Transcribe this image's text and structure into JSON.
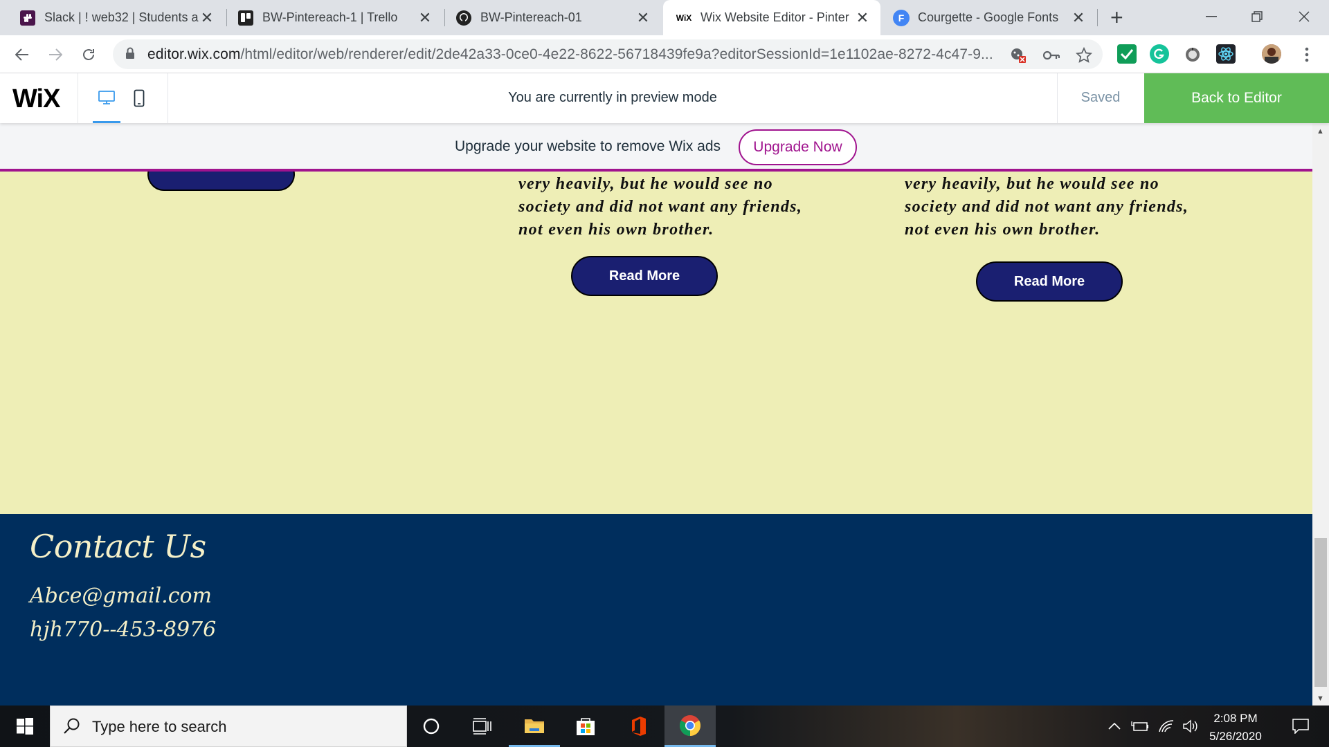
{
  "browser": {
    "tabs": [
      {
        "title": "Slack | ! web32 | Students a",
        "favicon": "slack-icon"
      },
      {
        "title": "BW-Pintereach-1 | Trello",
        "favicon": "trello-icon"
      },
      {
        "title": "BW-Pintereach-01",
        "favicon": "github-icon"
      },
      {
        "title": "Wix Website Editor - Pinter",
        "favicon": "wix-icon",
        "favicon_text": "WiX"
      },
      {
        "title": "Courgette - Google Fonts",
        "favicon": "google-fonts-icon",
        "favicon_text": "F"
      }
    ],
    "active_tab": 3,
    "url_host": "editor.wix.com",
    "url_path": "/html/editor/web/renderer/edit/2de42a33-0ce0-4e22-8622-56718439fe9a?editorSessionId=1e1102ae-8272-4c47-9..."
  },
  "wix": {
    "logo": "WiX",
    "preview_message": "You are currently in preview mode",
    "saved_label": "Saved",
    "back_button": "Back to Editor",
    "accent": "#60bc57"
  },
  "banner": {
    "message": "Upgrade your website to remove Wix ads",
    "button": "Upgrade Now",
    "color": "#a0138e"
  },
  "content": {
    "stories": [
      {
        "text": "very heavily, but he would see no\nsociety and did not want any friends,\nnot even his own brother.",
        "button": "Read More"
      },
      {
        "text": "very heavily, but he would see no\nsociety and did not want any friends,\nnot even his own brother.",
        "button": "Read More"
      }
    ],
    "background": "#eeeeb6",
    "button_color": "#1a1f71"
  },
  "footer": {
    "title": "Contact Us",
    "email": "Abce@gmail.com",
    "phone": "hjh770--453-8976",
    "background": "#002e5d"
  },
  "taskbar": {
    "search_placeholder": "Type here to search",
    "time": "2:08 PM",
    "date": "5/26/2020"
  }
}
